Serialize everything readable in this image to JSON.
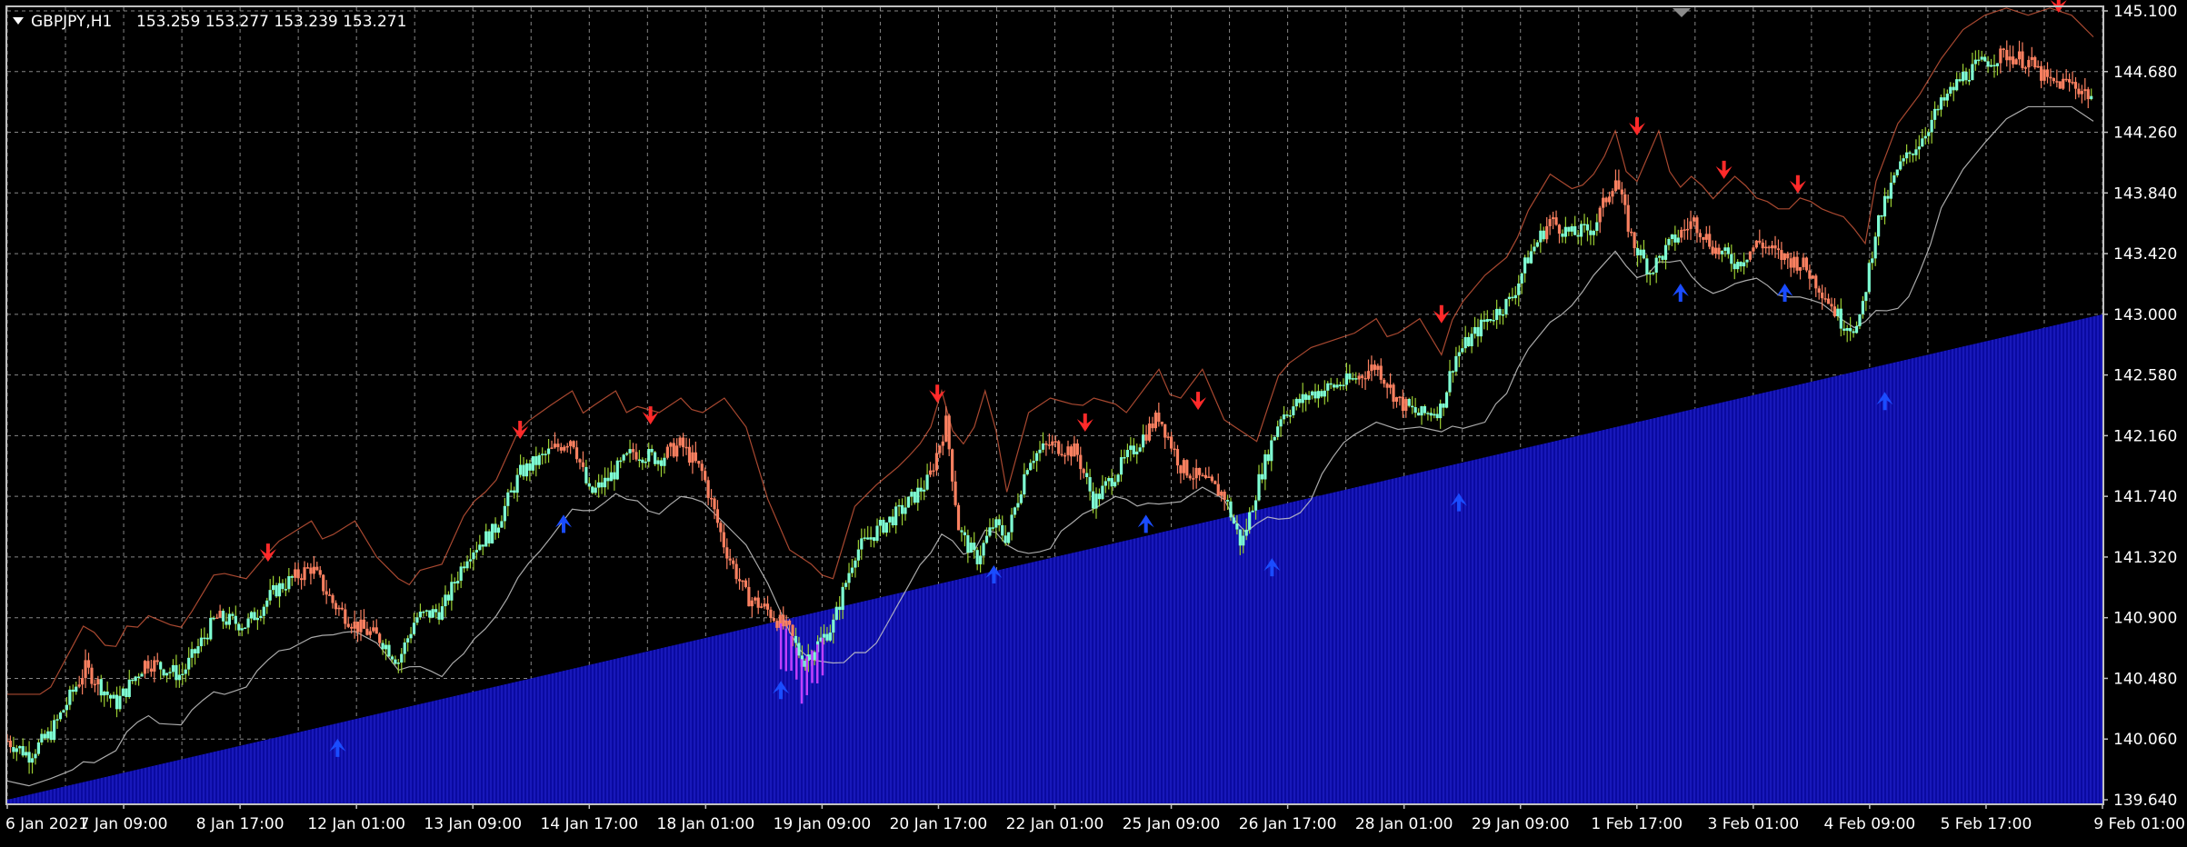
{
  "window": {
    "symbol_title": "GBPJPY,H1",
    "ohlc_readout": "153.259 153.277 153.239 153.271"
  },
  "colors": {
    "background": "#000000",
    "grid": "#c0c0c0",
    "frame": "#c0c0c0",
    "axis_text": "#ffffff",
    "bull_candle": "#7fffd4",
    "bull_wick": "#9acd32",
    "bear_candle": "#fa8060",
    "bear_wick": "#fa8060",
    "volume_area": "#0a0aa0",
    "volume_stripe": "#2a2ad8",
    "trail_down": "#e06040",
    "trail_up": "#c8c8c8",
    "arrow_down": "#ff2a2a",
    "arrow_up": "#1a4cff",
    "dip_bars": "#c040ff"
  },
  "icons": {
    "menu": "triangle-down-icon",
    "scroll_marker": "triangle-down-icon",
    "sell_signal": "arrow-down-icon",
    "buy_signal": "arrow-up-icon"
  },
  "chart_data": {
    "type": "candlestick",
    "symbol": "GBPJPY",
    "timeframe": "H1",
    "title": "GBPJPY,H1",
    "ylim": [
      139.64,
      145.1
    ],
    "grid": true,
    "y_ticks": [
      "145.100",
      "144.680",
      "144.260",
      "143.840",
      "143.420",
      "143.000",
      "142.580",
      "142.160",
      "141.740",
      "141.320",
      "140.900",
      "140.480",
      "140.060",
      "139.640"
    ],
    "x_ticks": [
      "6 Jan 2021",
      "7 Jan 09:00",
      "8 Jan 17:00",
      "12 Jan 01:00",
      "13 Jan 09:00",
      "14 Jan 17:00",
      "18 Jan 01:00",
      "19 Jan 09:00",
      "20 Jan 17:00",
      "22 Jan 01:00",
      "25 Jan 09:00",
      "26 Jan 17:00",
      "28 Jan 01:00",
      "29 Jan 09:00",
      "1 Feb 17:00",
      "3 Feb 01:00",
      "4 Feb 09:00",
      "5 Feb 17:00",
      "9 Feb 01:00"
    ],
    "price_path": [
      [
        0,
        140.05
      ],
      [
        0.5,
        139.95
      ],
      [
        1,
        140.1
      ],
      [
        1.8,
        140.55
      ],
      [
        2.5,
        140.3
      ],
      [
        3.2,
        140.6
      ],
      [
        4,
        140.5
      ],
      [
        4.8,
        140.9
      ],
      [
        5.5,
        140.85
      ],
      [
        6.2,
        141.1
      ],
      [
        7,
        141.25
      ],
      [
        7.5,
        141.0
      ],
      [
        8,
        140.85
      ],
      [
        8.6,
        140.75
      ],
      [
        9,
        140.6
      ],
      [
        9.4,
        140.9
      ],
      [
        10,
        140.95
      ],
      [
        10.6,
        141.35
      ],
      [
        11.2,
        141.5
      ],
      [
        11.8,
        141.9
      ],
      [
        12.5,
        142.05
      ],
      [
        13,
        142.15
      ],
      [
        13.4,
        141.75
      ],
      [
        13.8,
        141.85
      ],
      [
        14.4,
        142.05
      ],
      [
        15,
        142.0
      ],
      [
        15.5,
        142.1
      ],
      [
        16,
        141.9
      ],
      [
        16.5,
        141.4
      ],
      [
        17,
        141.05
      ],
      [
        17.5,
        140.95
      ],
      [
        18,
        140.8
      ],
      [
        18.3,
        140.6
      ],
      [
        18.6,
        140.7
      ],
      [
        19,
        140.85
      ],
      [
        19.5,
        141.35
      ],
      [
        20,
        141.5
      ],
      [
        20.6,
        141.65
      ],
      [
        21.2,
        141.85
      ],
      [
        21.6,
        142.25
      ],
      [
        21.9,
        141.5
      ],
      [
        22.3,
        141.3
      ],
      [
        22.7,
        141.55
      ],
      [
        23,
        141.45
      ],
      [
        23.5,
        142.0
      ],
      [
        24,
        142.1
      ],
      [
        24.6,
        142.05
      ],
      [
        25,
        141.7
      ],
      [
        25.5,
        141.9
      ],
      [
        26,
        142.1
      ],
      [
        26.5,
        142.3
      ],
      [
        27,
        141.95
      ],
      [
        27.5,
        141.85
      ],
      [
        28,
        141.75
      ],
      [
        28.4,
        141.4
      ],
      [
        28.8,
        141.85
      ],
      [
        29.3,
        142.3
      ],
      [
        30,
        142.45
      ],
      [
        30.5,
        142.5
      ],
      [
        31,
        142.55
      ],
      [
        31.5,
        142.65
      ],
      [
        32,
        142.4
      ],
      [
        32.5,
        142.3
      ],
      [
        33,
        142.35
      ],
      [
        33.3,
        142.7
      ],
      [
        34,
        142.95
      ],
      [
        34.6,
        143.1
      ],
      [
        35,
        143.4
      ],
      [
        35.5,
        143.65
      ],
      [
        36,
        143.55
      ],
      [
        36.5,
        143.6
      ],
      [
        37,
        143.95
      ],
      [
        37.4,
        143.5
      ],
      [
        37.8,
        143.3
      ],
      [
        38.3,
        143.5
      ],
      [
        38.8,
        143.65
      ],
      [
        39.3,
        143.45
      ],
      [
        39.8,
        143.35
      ],
      [
        40.3,
        143.5
      ],
      [
        40.8,
        143.4
      ],
      [
        41.3,
        143.35
      ],
      [
        41.8,
        143.15
      ],
      [
        42.2,
        142.95
      ],
      [
        42.6,
        142.9
      ],
      [
        43,
        143.6
      ],
      [
        43.5,
        144.0
      ],
      [
        44,
        144.2
      ],
      [
        44.5,
        144.45
      ],
      [
        45,
        144.65
      ],
      [
        45.5,
        144.75
      ],
      [
        46,
        144.8
      ],
      [
        46.5,
        144.75
      ],
      [
        47,
        144.6
      ],
      [
        47.5,
        144.6
      ],
      [
        48,
        144.5
      ]
    ],
    "volume_baseline": [
      [
        0,
        139.64
      ],
      [
        48,
        143.0
      ]
    ],
    "sell_signals": [
      [
        6,
        141.3
      ],
      [
        11.8,
        142.15
      ],
      [
        14.8,
        142.25
      ],
      [
        21.4,
        142.4
      ],
      [
        24.8,
        142.2
      ],
      [
        27.4,
        142.35
      ],
      [
        33,
        142.95
      ],
      [
        37.5,
        144.25
      ],
      [
        39.5,
        143.95
      ],
      [
        41.2,
        143.85
      ],
      [
        47.2,
        145.1
      ]
    ],
    "buy_signals": [
      [
        7.6,
        140.05
      ],
      [
        12.8,
        141.6
      ],
      [
        17.8,
        140.45
      ],
      [
        22.7,
        141.25
      ],
      [
        26.2,
        141.6
      ],
      [
        29.1,
        141.3
      ],
      [
        33.4,
        141.75
      ],
      [
        38.5,
        143.2
      ],
      [
        40.9,
        143.2
      ],
      [
        43.2,
        142.45
      ]
    ]
  }
}
